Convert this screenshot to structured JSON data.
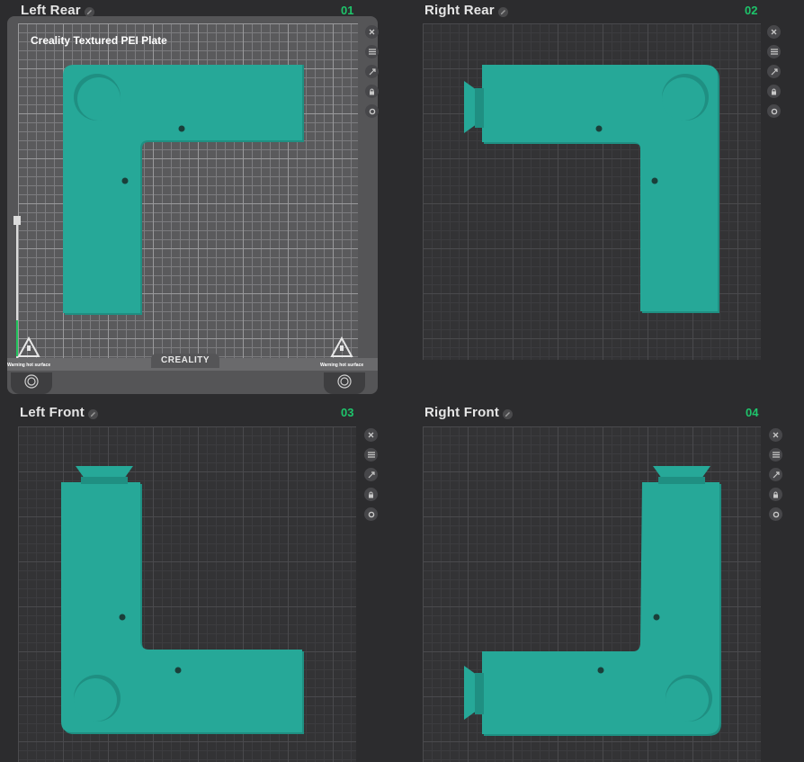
{
  "plates": [
    {
      "title": "Left Rear",
      "number": "01",
      "active": true
    },
    {
      "title": "Right Rear",
      "number": "02",
      "active": false
    },
    {
      "title": "Left Front",
      "number": "03",
      "active": false
    },
    {
      "title": "Right Front",
      "number": "04",
      "active": false
    }
  ],
  "plate_type_label": "Creality Textured PEI Plate",
  "brand": "CREALITY",
  "warning_label": "Warning hot surface",
  "colors": {
    "part": "#26a898",
    "active_number": "#1ec56b",
    "background": "#2c2c2e"
  },
  "side_icons": [
    "close-icon",
    "arrange-icon",
    "orient-icon",
    "lock-icon",
    "settings-icon"
  ]
}
